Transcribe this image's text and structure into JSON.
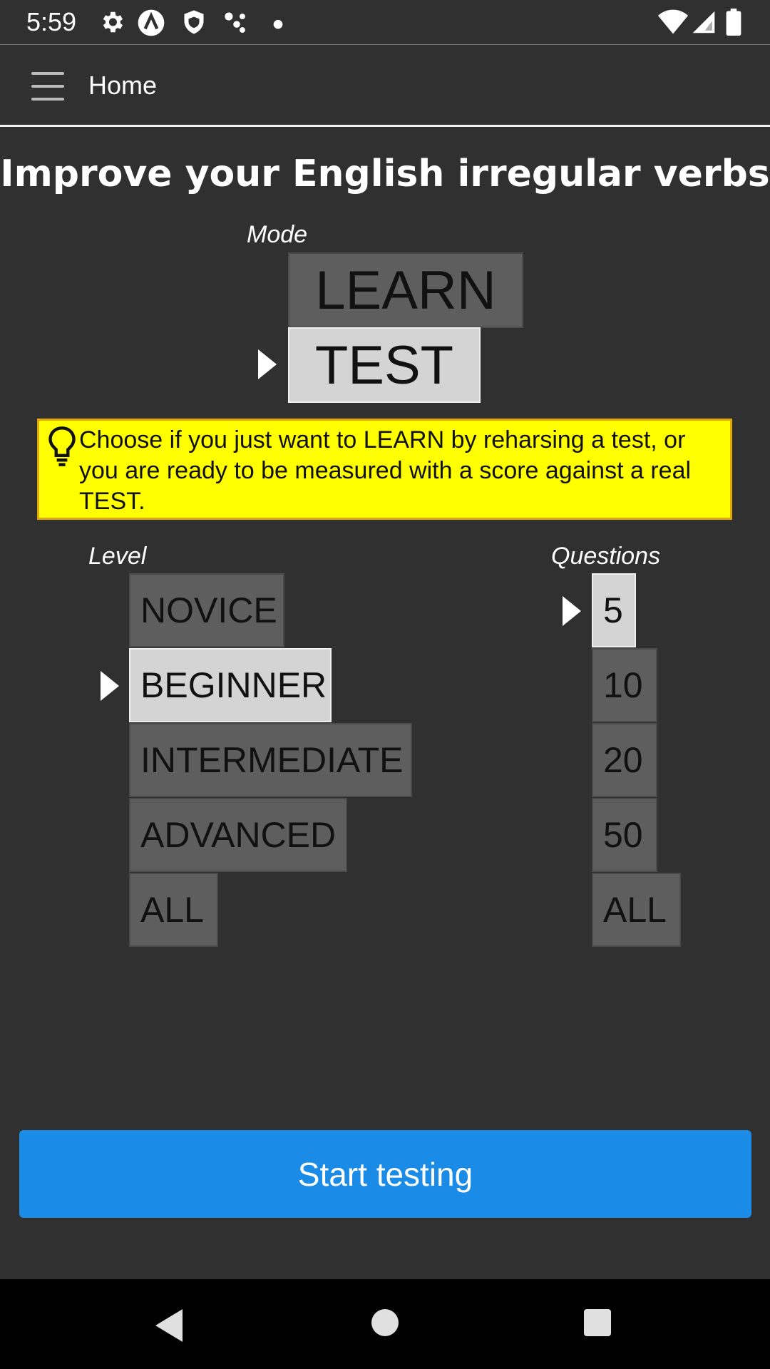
{
  "status_bar": {
    "time": "5:59",
    "icons_left": [
      "gear-icon",
      "vpn-icon",
      "shield-icon",
      "dots-icon",
      "dot-icon"
    ],
    "icons_right": [
      "wifi-icon",
      "signal-icon",
      "battery-icon"
    ]
  },
  "app_bar": {
    "menu_icon": "menu-icon",
    "title": "Home"
  },
  "main": {
    "title": "Improve your English irregular verbs",
    "mode": {
      "label": "Mode",
      "options": [
        "LEARN",
        "TEST"
      ],
      "selected": "TEST"
    },
    "hint": {
      "icon": "lightbulb-icon",
      "text": "Choose if you just want to LEARN by reharsing a test, or you are ready to be measured with a score against a real TEST."
    },
    "level": {
      "label": "Level",
      "options": [
        "NOVICE",
        "BEGINNER",
        "INTERMEDIATE",
        "ADVANCED",
        "ALL"
      ],
      "selected": "BEGINNER"
    },
    "questions": {
      "label": "Questions",
      "options": [
        "5",
        "10",
        "20",
        "50",
        "ALL"
      ],
      "selected": "5"
    },
    "start_button": "Start testing"
  },
  "nav_bar": {
    "icons": [
      "back-icon",
      "home-icon",
      "recent-apps-icon"
    ]
  },
  "colors": {
    "background": "#303030",
    "option_bg": "#5e5e5e",
    "option_selected_bg": "#d4d4d4",
    "hint_bg": "#ffff00",
    "primary_button": "#1a8be6"
  }
}
